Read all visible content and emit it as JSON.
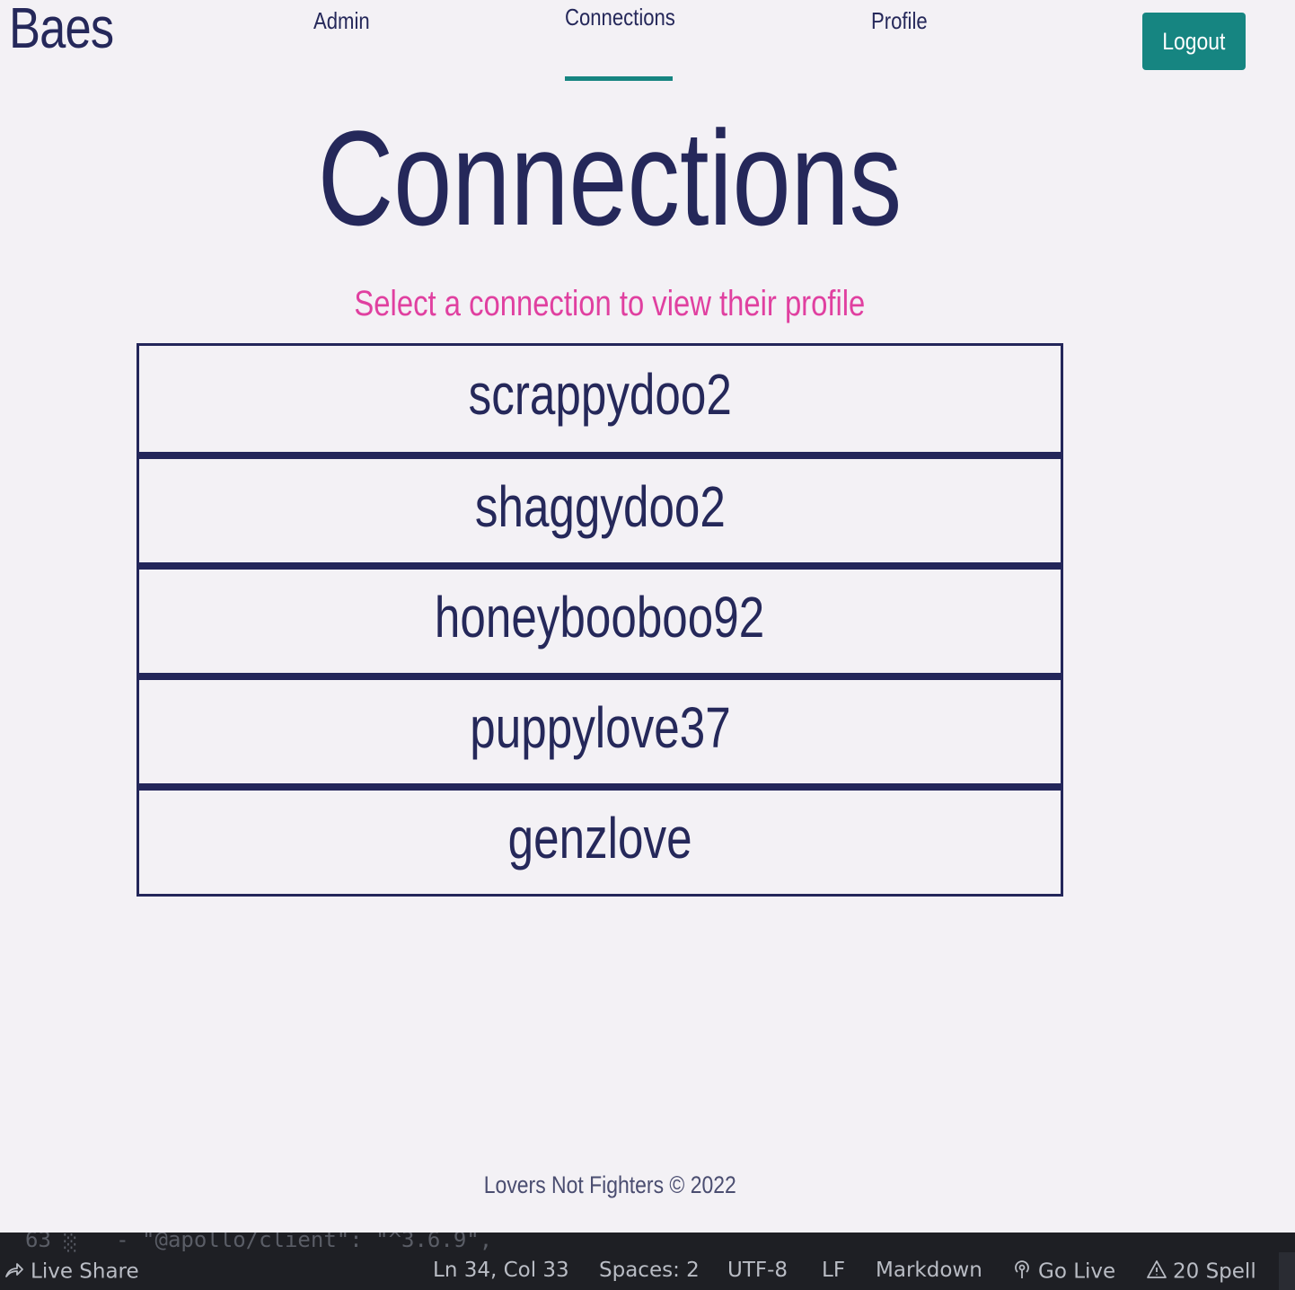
{
  "app": {
    "brand": "Baes"
  },
  "nav": {
    "items": [
      {
        "label": "Admin"
      },
      {
        "label": "Connections"
      },
      {
        "label": "Profile"
      }
    ],
    "logout_label": "Logout",
    "active": "Connections"
  },
  "main": {
    "title": "Connections",
    "subtitle": "Select a connection to view their profile",
    "connections": [
      "scrappydoo2",
      "shaggydoo2",
      "honeybooboo92",
      "puppylove37",
      "genzlove"
    ]
  },
  "footer": {
    "text": "Lovers Not Fighters © 2022"
  },
  "editor": {
    "line_text": "63 ░   - \"@apollo/client\": \"^3.6.9\","
  },
  "status_bar": {
    "live_share": "Live Share",
    "cursor": "Ln 34, Col 33",
    "spaces": "Spaces: 2",
    "encoding": "UTF-8",
    "eol": "LF",
    "language": "Markdown",
    "go_live": "Go Live",
    "spell": "20 Spell"
  },
  "colors": {
    "accent": "#168581",
    "text": "#25285a",
    "subtitle": "#e040a0",
    "background": "#f3f1f5"
  }
}
